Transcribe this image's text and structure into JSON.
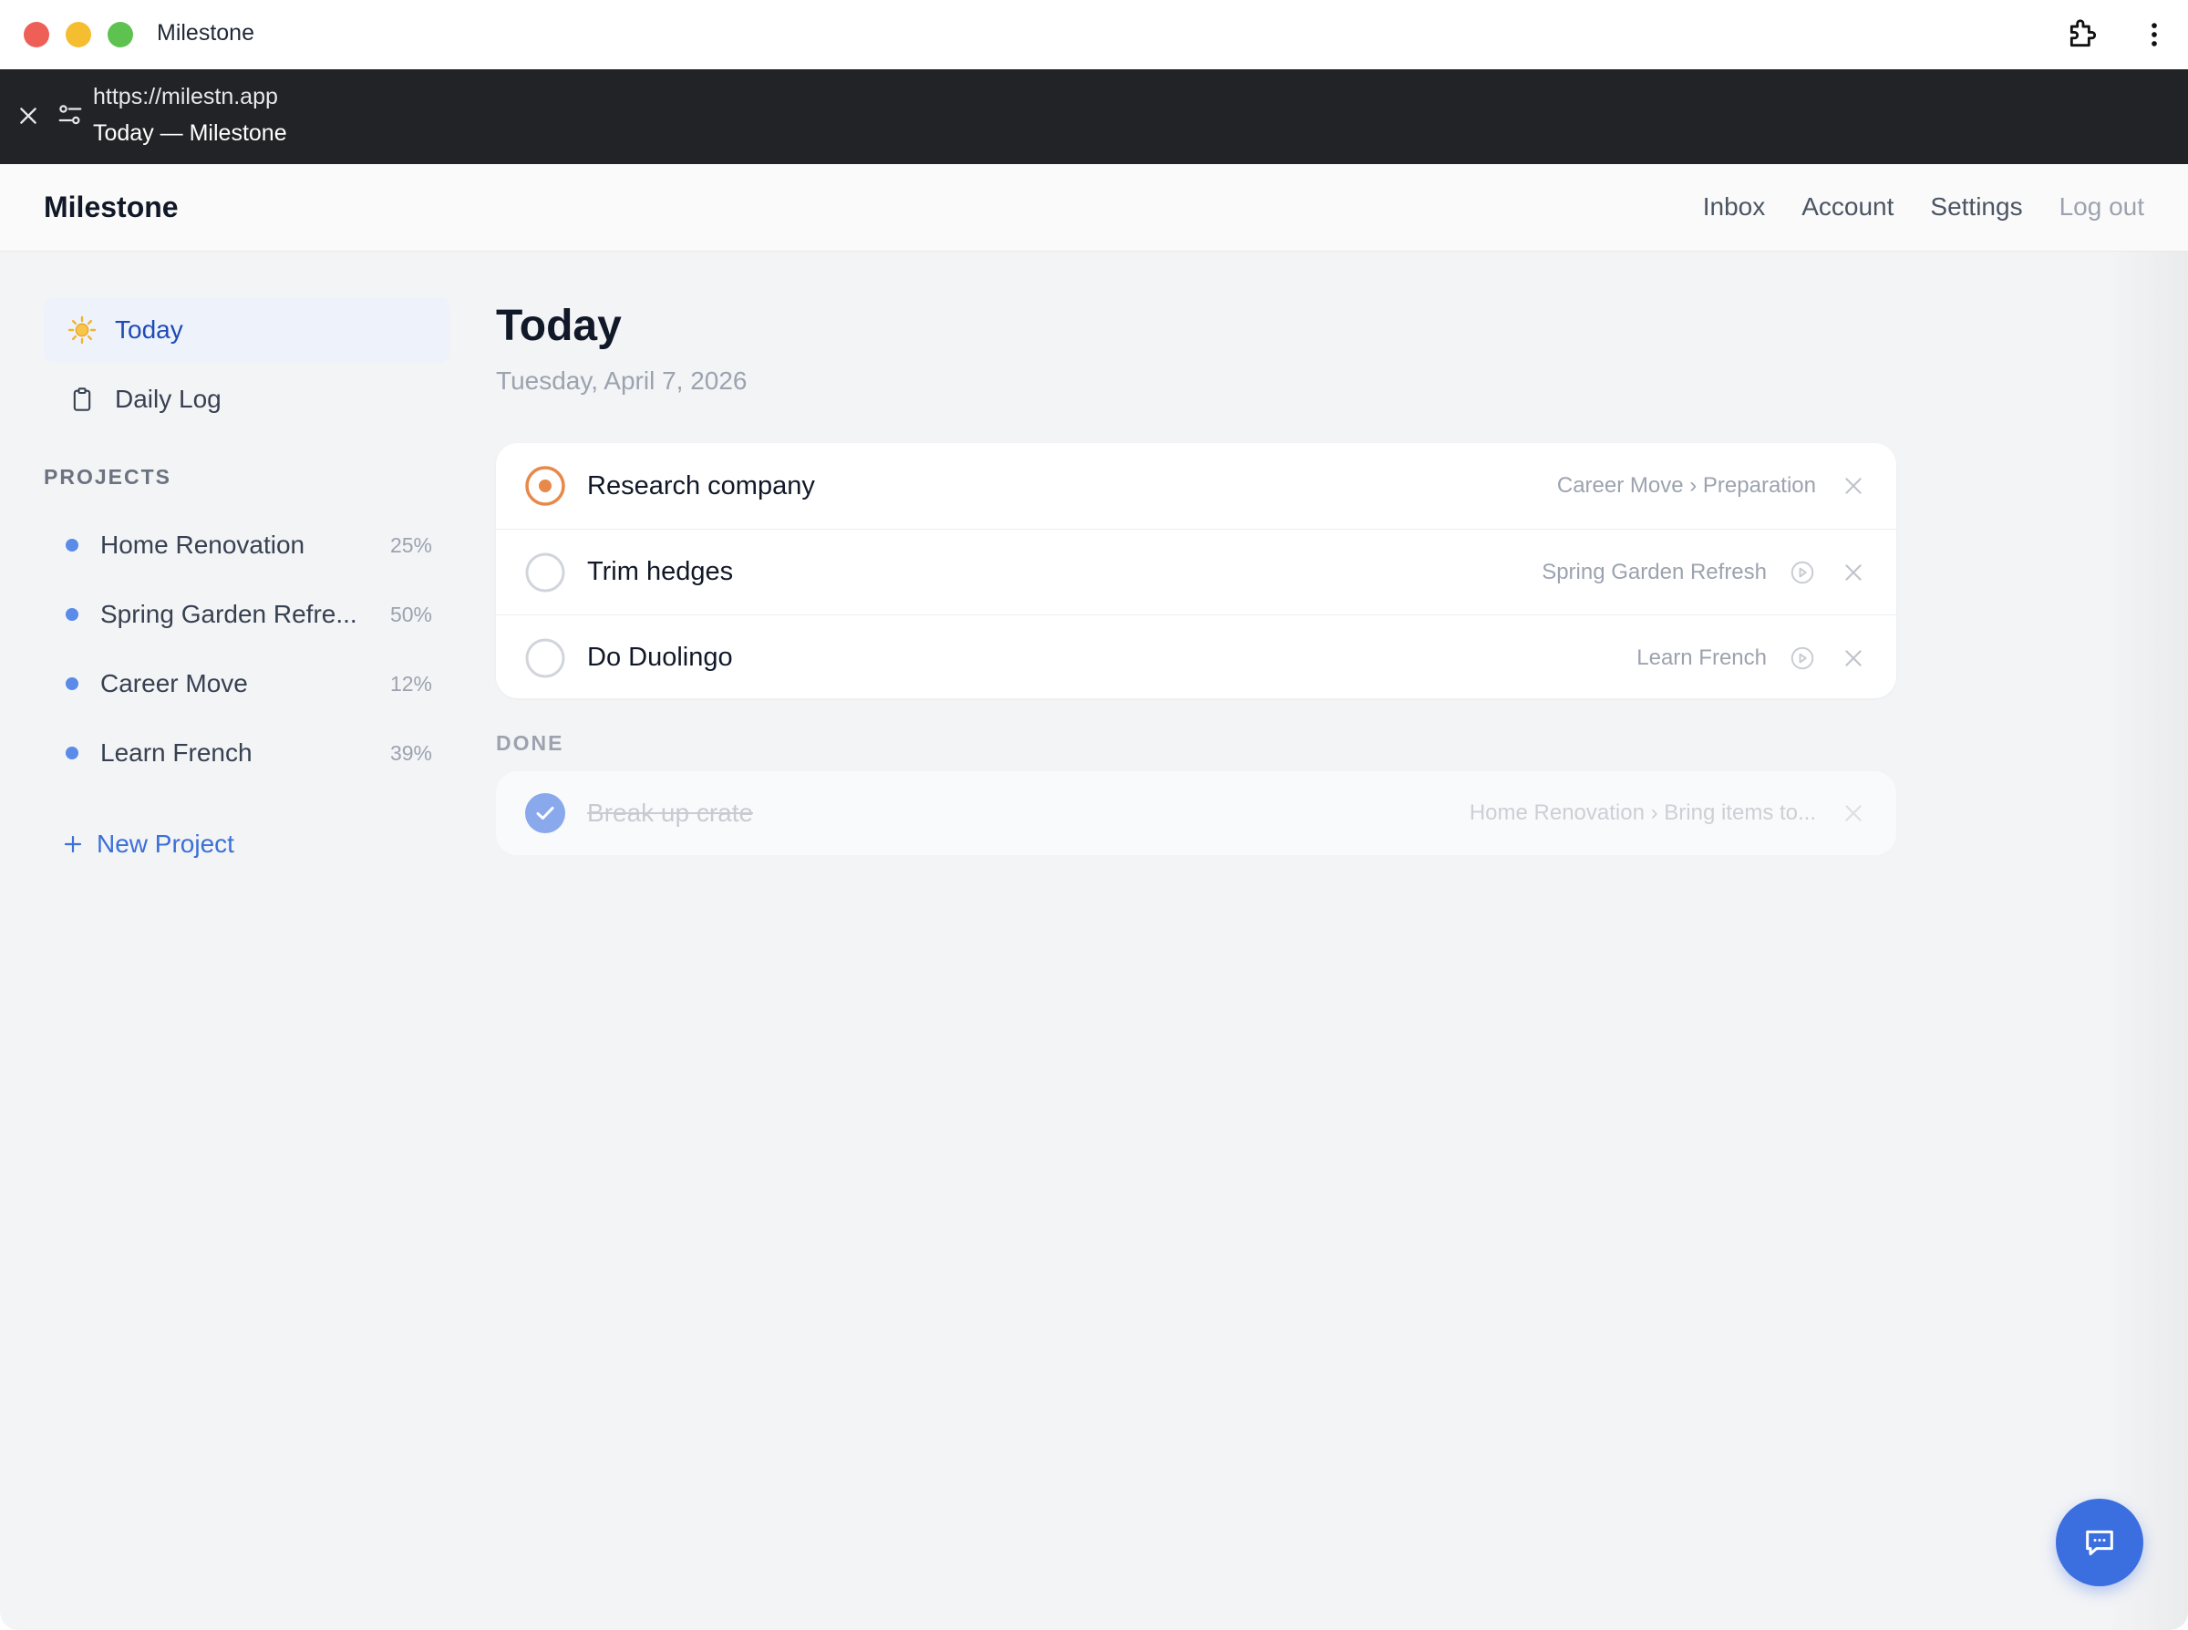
{
  "window": {
    "title": "Milestone"
  },
  "browser": {
    "url": "https://milestn.app",
    "page_title": "Today — Milestone"
  },
  "header": {
    "brand": "Milestone",
    "nav": [
      "Inbox",
      "Account",
      "Settings",
      "Log out"
    ]
  },
  "sidebar": {
    "items": [
      {
        "label": "Today",
        "icon": "sun-icon",
        "active": true
      },
      {
        "label": "Daily Log",
        "icon": "clipboard-icon",
        "active": false
      }
    ],
    "projects_heading": "PROJECTS",
    "projects": [
      {
        "name": "Home Renovation",
        "progress": "25%"
      },
      {
        "name": "Spring Garden Refre...",
        "progress": "50%"
      },
      {
        "name": "Career Move",
        "progress": "12%"
      },
      {
        "name": "Learn French",
        "progress": "39%"
      }
    ],
    "new_project": "New Project"
  },
  "main": {
    "title": "Today",
    "date": "Tuesday, April 7, 2026",
    "tasks": [
      {
        "name": "Research company",
        "context": "Career Move › Preparation",
        "status": "in-progress"
      },
      {
        "name": "Trim hedges",
        "context": "Spring Garden Refresh",
        "status": "todo"
      },
      {
        "name": "Do Duolingo",
        "context": "Learn French",
        "status": "todo"
      }
    ],
    "done_heading": "DONE",
    "done": [
      {
        "name": "Break up crate",
        "context": "Home Renovation › Bring items to..."
      }
    ]
  },
  "colors": {
    "accent": "#3b6fe0",
    "in_progress": "#e8894a",
    "project_dot": "#5a8be8",
    "active_bg": "#eef2fb"
  }
}
